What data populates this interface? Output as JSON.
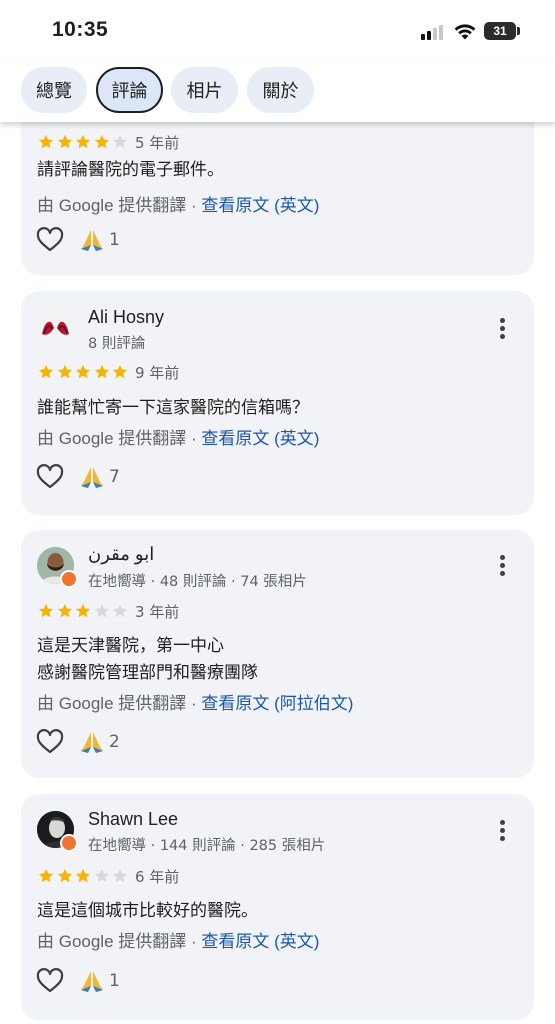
{
  "status": {
    "time": "10:35",
    "battery": "31"
  },
  "tabs": [
    {
      "label": "總覽"
    },
    {
      "label": "評論"
    },
    {
      "label": "相片"
    },
    {
      "label": "關於"
    }
  ],
  "reviews": [
    {
      "rating": 4,
      "ago": "5 年前",
      "text": "請評論醫院的電子郵件。",
      "translation_prefix": "由 Google 提供翻譯 · ",
      "translation_link": "查看原文 (英文)",
      "reactions": "1"
    },
    {
      "name": "Ali Hosny",
      "meta": "8 則評論",
      "rating": 5,
      "ago": "9 年前",
      "text": "誰能幫忙寄一下這家醫院的信箱嗎？",
      "translation_prefix": "由 Google 提供翻譯 · ",
      "translation_link": "查看原文 (英文)",
      "reactions": "7"
    },
    {
      "name": "ابو مقرن",
      "meta": "在地嚮導 · 48 則評論 · 74 張相片",
      "rating": 3,
      "ago": "3 年前",
      "text_line1": "這是天津醫院，第一中心",
      "text_line2": "感謝醫院管理部門和醫療團隊",
      "translation_prefix": "由 Google 提供翻譯 · ",
      "translation_link": "查看原文 (阿拉伯文)",
      "reactions": "2"
    },
    {
      "name": "Shawn Lee",
      "meta": "在地嚮導 · 144 則評論 · 285 張相片",
      "rating": 3,
      "ago": "6 年前",
      "text": "這是這個城市比較好的醫院。",
      "translation_prefix": "由 Google 提供翻譯 · ",
      "translation_link": "查看原文 (英文)",
      "reactions": "1"
    }
  ],
  "colors": {
    "star": "#f4b400",
    "star_empty": "#d9d9d9",
    "link": "#1a56b8",
    "card": "#f1f3f6",
    "local_guide_badge": "#f07430"
  },
  "icons": [
    "heart-outline-icon",
    "folded-hands-icon",
    "more-vert-icon",
    "star-icon"
  ]
}
